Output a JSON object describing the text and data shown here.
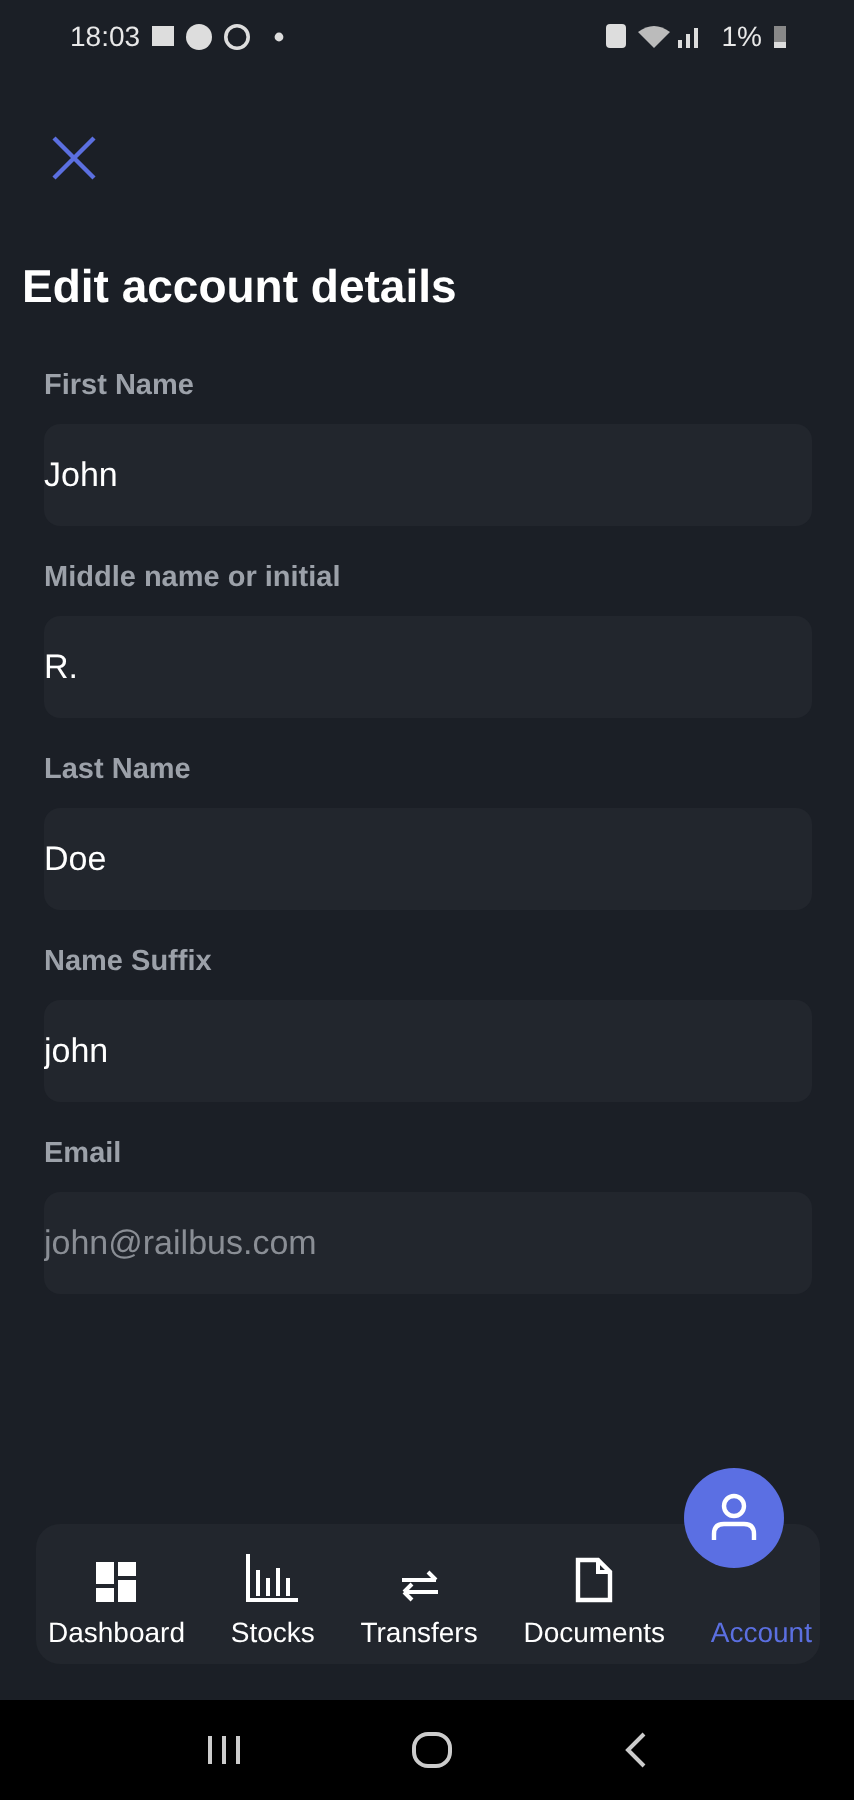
{
  "status_bar": {
    "time": "18:03",
    "battery": "1%"
  },
  "title": "Edit account details",
  "fields": [
    {
      "label": "First Name",
      "value": "John",
      "disabled": false
    },
    {
      "label": "Middle name or initial",
      "value": "R.",
      "disabled": false
    },
    {
      "label": "Last Name",
      "value": "Doe",
      "disabled": false
    },
    {
      "label": "Name Suffix",
      "value": "john",
      "disabled": false
    },
    {
      "label": "Email",
      "value": "john@railbus.com",
      "disabled": true
    }
  ],
  "nav": [
    {
      "label": "Dashboard",
      "kind": "dashboard",
      "selected": false
    },
    {
      "label": "Stocks",
      "kind": "chart",
      "selected": false
    },
    {
      "label": "Transfers",
      "kind": "transfer",
      "selected": false
    },
    {
      "label": "Documents",
      "kind": "document",
      "selected": false
    },
    {
      "label": "Account",
      "kind": "user",
      "selected": true
    }
  ]
}
